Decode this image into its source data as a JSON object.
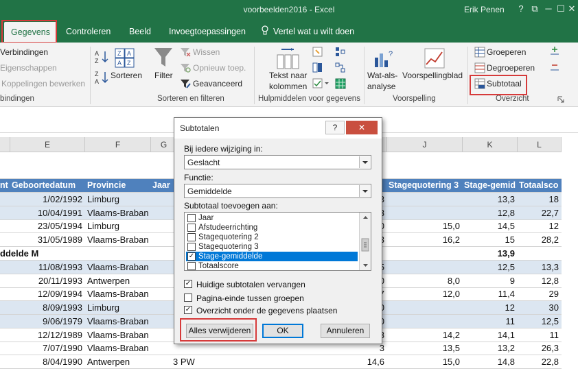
{
  "window": {
    "title": "voorbeelden2016 - Excel",
    "user": "Erik Penen",
    "controls": [
      "?",
      "⧉",
      "─",
      "☐",
      "✕"
    ]
  },
  "tabs": [
    {
      "label": "Gegevens",
      "active": true
    },
    {
      "label": "Controleren"
    },
    {
      "label": "Beeld"
    },
    {
      "label": "Invoegtoepassingen"
    },
    {
      "label": "Vertel wat u wilt doen",
      "icon": "lightbulb-icon"
    }
  ],
  "ribbon": {
    "connections": {
      "items": [
        "Verbindingen",
        "Eigenschappen",
        "Koppelingen bewerken"
      ],
      "group_label": "bindingen"
    },
    "sort_filter": {
      "sort": "Sorteren",
      "filter": "Filter",
      "clear": "Wissen",
      "reapply": "Opnieuw toep.",
      "advanced": "Geavanceerd",
      "group_label": "Sorteren en filteren"
    },
    "data_tools": {
      "text_to_columns_1": "Tekst naar",
      "text_to_columns_2": "kolommen",
      "group_label": "Hulpmiddelen voor gegevens"
    },
    "forecast": {
      "what_if_1": "Wat-als-",
      "what_if_2": "analyse",
      "forecast_sheet": "Voorspellingblad",
      "group_label": "Voorspelling"
    },
    "outline": {
      "group": "Groeperen",
      "ungroup": "Degroeperen",
      "subtotal": "Subtotaal",
      "group_label": "Overzicht"
    }
  },
  "sheet": {
    "columns": [
      "E",
      "F",
      "G",
      "J",
      "K",
      "L"
    ],
    "header_row": [
      "nt",
      "Geboortedatum",
      "Provincie",
      "Jaar",
      "Stagequotering 3",
      "Stage-gemid",
      "Totaalsco"
    ],
    "rows": [
      {
        "date": "1/02/1992",
        "prov": "Limburg",
        "h": "3",
        "j": "",
        "k": "13,3",
        "l": "18",
        "band": true
      },
      {
        "date": "10/04/1991",
        "prov": "Vlaams-Braban",
        "h": "3",
        "j": "",
        "k": "12,8",
        "l": "22,7",
        "band": true
      },
      {
        "date": "23/05/1994",
        "prov": "Limburg",
        "h": "0",
        "j": "15,0",
        "k": "14,5",
        "l": "12",
        "band": false
      },
      {
        "date": "31/05/1989",
        "prov": "Vlaams-Braban",
        "h": "3",
        "j": "16,2",
        "k": "15",
        "l": "28,2",
        "band": false
      },
      {
        "label": "ddelde M",
        "k": "13,9",
        "group": true
      },
      {
        "date": "11/08/1993",
        "prov": "Vlaams-Braban",
        "h": "5",
        "j": "",
        "k": "12,5",
        "l": "13,3",
        "band": true
      },
      {
        "date": "20/11/1993",
        "prov": "Antwerpen",
        "h": "0",
        "j": "8,0",
        "k": "9",
        "l": "12,8",
        "band": false
      },
      {
        "date": "12/09/1994",
        "prov": "Vlaams-Braban",
        "h": "7",
        "j": "12,0",
        "k": "11,4",
        "l": "29",
        "band": false
      },
      {
        "date": "8/09/1993",
        "prov": "Limburg",
        "h": "0",
        "j": "",
        "k": "12",
        "l": "30",
        "band": true
      },
      {
        "date": "9/06/1979",
        "prov": "Vlaams-Braban",
        "h": "0",
        "j": "",
        "k": "11",
        "l": "12,5",
        "band": true
      },
      {
        "date": "12/12/1989",
        "prov": "Vlaams-Braban",
        "h": "3",
        "j": "14,2",
        "k": "14,1",
        "l": "11",
        "band": false
      },
      {
        "date": "7/07/1990",
        "prov": "Vlaams-Braban",
        "h": "3",
        "j": "13,5",
        "k": "13,2",
        "l": "26,3",
        "band": false
      },
      {
        "date": "8/04/1990",
        "prov": "Antwerpen",
        "g": "3 PW",
        "h": "14,6",
        "j": "15,0",
        "k": "14,8",
        "l": "22,8",
        "band": false
      }
    ]
  },
  "dialog": {
    "title": "Subtotalen",
    "help": "?",
    "close": "✕",
    "change_label": "Bij iedere wijziging in:",
    "change_value": "Geslacht",
    "function_label": "Functie:",
    "function_value": "Gemiddelde",
    "add_label": "Subtotaal toevoegen aan:",
    "fields": [
      {
        "label": "Jaar",
        "checked": false
      },
      {
        "label": "Afstudeerrichting",
        "checked": false
      },
      {
        "label": "Stagequotering 2",
        "checked": false
      },
      {
        "label": "Stagequotering 3",
        "checked": false
      },
      {
        "label": "Stage-gemiddelde",
        "checked": true,
        "selected": true
      },
      {
        "label": "Totaalscore",
        "checked": false
      }
    ],
    "options": [
      {
        "label": "Huidige subtotalen vervangen",
        "checked": true
      },
      {
        "label": "Pagina-einde tussen groepen",
        "checked": false
      },
      {
        "label": "Overzicht onder de gegevens plaatsen",
        "checked": true
      }
    ],
    "remove_all": "Alles verwijderen",
    "ok": "OK",
    "cancel": "Annuleren"
  }
}
